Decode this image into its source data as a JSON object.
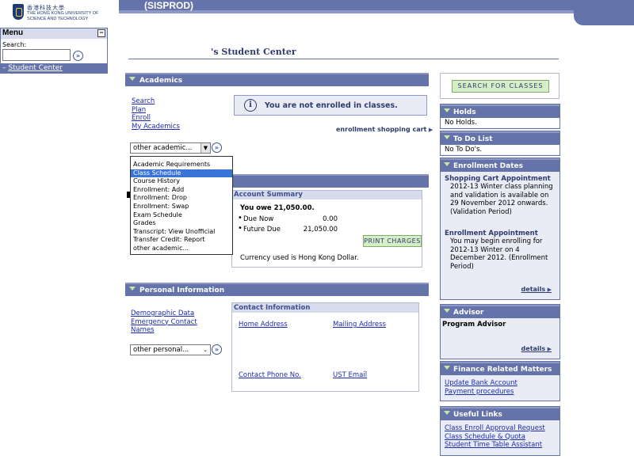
{
  "header": {
    "logo_cn": "香港科技大學",
    "logo_en_line1": "THE HONG KONG UNIVERSITY OF",
    "logo_en_line2": "SCIENCE AND TECHNOLOGY",
    "system_name": "(SISPROD)"
  },
  "menu": {
    "title": "Menu",
    "minimize": "−",
    "search_label": "Search:",
    "search_value": "",
    "current_item": "Student Center"
  },
  "page": {
    "title": "'s Student Center"
  },
  "academics": {
    "header": "Academics",
    "links": [
      "Search",
      "Plan",
      "Enroll",
      "My Academics"
    ],
    "notice": "You are not enrolled in classes.",
    "cart_link": "enrollment shopping cart",
    "select_value": "other academic...",
    "dropdown_options": [
      "Academic Requirements",
      "Class Schedule",
      "Course History",
      "Enrollment: Add",
      "Enrollment: Drop",
      "Enrollment: Swap",
      "Exam Schedule",
      "Grades",
      "Transcript: View Unofficial",
      "Transfer Credit: Report",
      "other academic..."
    ],
    "selected_option": "Class Schedule"
  },
  "finances": {
    "account_summary_title": "Account Summary",
    "you_owe": "You owe 21,050.00.",
    "due_now_label": "Due Now",
    "due_now_value": "0.00",
    "future_due_label": "Future Due",
    "future_due_value": "21,050.00",
    "print_button": "Print Charges",
    "currency_note": "Currency used is Hong Kong Dollar."
  },
  "personal": {
    "header": "Personal Information",
    "links": [
      "Demographic Data",
      "Emergency Contact",
      "Names"
    ],
    "select_value": "other personal...",
    "contact_title": "Contact Information",
    "home_address": "Home Address",
    "mailing_address": "Mailing Address",
    "contact_phone": "Contact Phone No.",
    "ust_email": "UST Email"
  },
  "right": {
    "search_button": "Search For Classes",
    "holds": {
      "title": "Holds",
      "body": "No Holds."
    },
    "todo": {
      "title": "To Do List",
      "body": "No To Do's."
    },
    "enrollment_dates": {
      "title": "Enrollment Dates",
      "appt1_title": "Shopping Cart Appointment",
      "appt1_text": "2012-13 Winter class planning and validation is available on 29 November 2012 onwards. (Validation Period)",
      "appt2_title": "Enrollment Appointment",
      "appt2_text": "You may begin enrolling for 2012-13 Winter on 4 December 2012. (Enrollment Period)",
      "details": "details"
    },
    "advisor": {
      "title": "Advisor",
      "body": "Program Advisor",
      "details": "details"
    },
    "finance": {
      "title": "Finance Related Matters",
      "links": [
        "Update Bank Account",
        "Payment procedures"
      ]
    },
    "useful": {
      "title": "Useful Links",
      "links": [
        "Class Enroll Approval Request",
        "Class Schedule & Quota",
        "Student Time Table Assistant"
      ]
    }
  },
  "colors": {
    "header_blue": "#6473aa",
    "link_blue": "#1b2bb1",
    "button_green": "#d6eec8",
    "panel_bg": "#e9ecf5"
  }
}
